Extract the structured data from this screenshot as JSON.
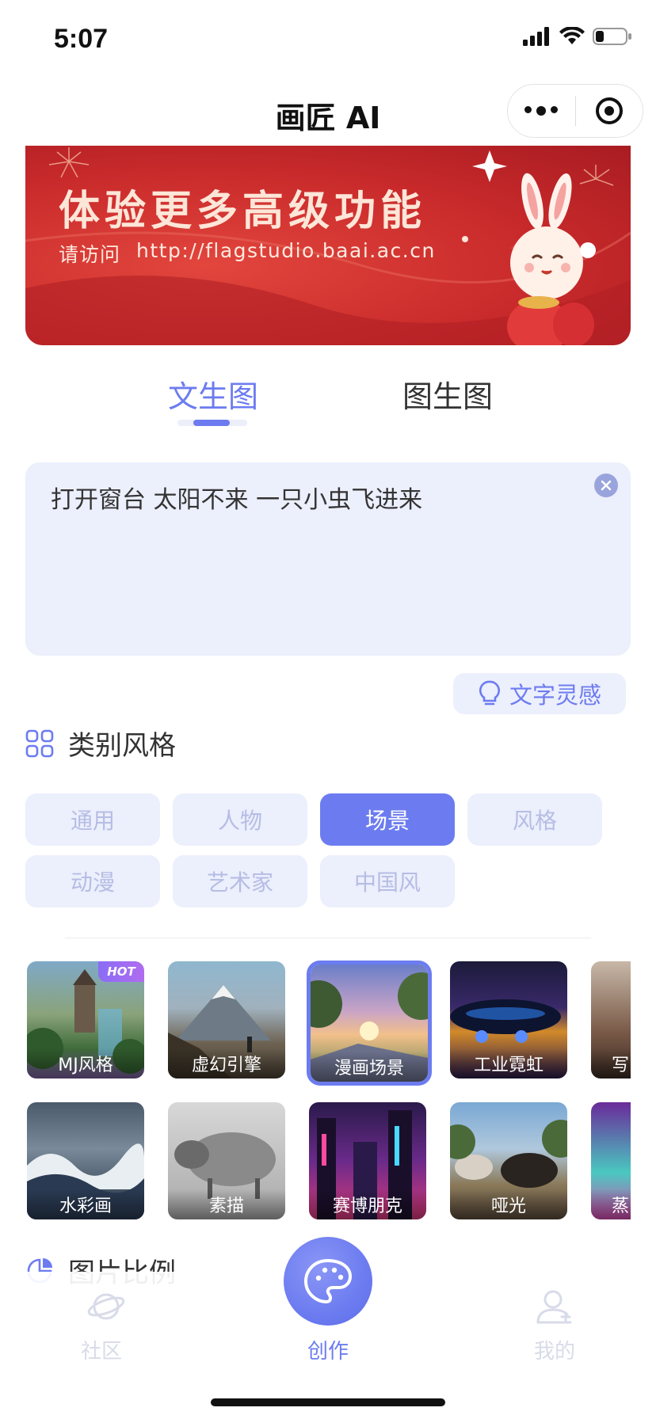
{
  "status_bar": {
    "time": "5:07"
  },
  "nav": {
    "title": "画匠 AI"
  },
  "banner": {
    "title": "体验更多高级功能",
    "visit_label": "请访问",
    "url": "http://flagstudio.baai.ac.cn"
  },
  "tabs": [
    {
      "label": "文生图",
      "active": true
    },
    {
      "label": "图生图",
      "active": false
    }
  ],
  "prompt": {
    "value": "打开窗台 太阳不来 一只小虫飞进来"
  },
  "inspiration_button": {
    "label": "文字灵感"
  },
  "category_section": {
    "title": "类别风格"
  },
  "categories": [
    {
      "label": "通用",
      "active": false
    },
    {
      "label": "人物",
      "active": false
    },
    {
      "label": "场景",
      "active": true
    },
    {
      "label": "风格",
      "active": false
    },
    {
      "label": "动漫",
      "active": false
    },
    {
      "label": "艺术家",
      "active": false
    },
    {
      "label": "中国风",
      "active": false
    }
  ],
  "styles_row1": [
    {
      "label": "MJ风格",
      "badge": "HOT"
    },
    {
      "label": "虚幻引擎"
    },
    {
      "label": "漫画场景",
      "selected": true
    },
    {
      "label": "工业霓虹"
    },
    {
      "label": "写"
    }
  ],
  "styles_row2": [
    {
      "label": "水彩画"
    },
    {
      "label": "素描"
    },
    {
      "label": "赛博朋克"
    },
    {
      "label": "哑光"
    },
    {
      "label": "蒸"
    }
  ],
  "ratio_section": {
    "title": "图片比例"
  },
  "bottom_nav": [
    {
      "label": "社区",
      "active": false
    },
    {
      "label": "创作",
      "active": true
    },
    {
      "label": "我的",
      "active": false
    }
  ],
  "colors": {
    "accent": "#6c7cf0",
    "soft": "#eceffc",
    "banner_red": "#c92a2b"
  }
}
